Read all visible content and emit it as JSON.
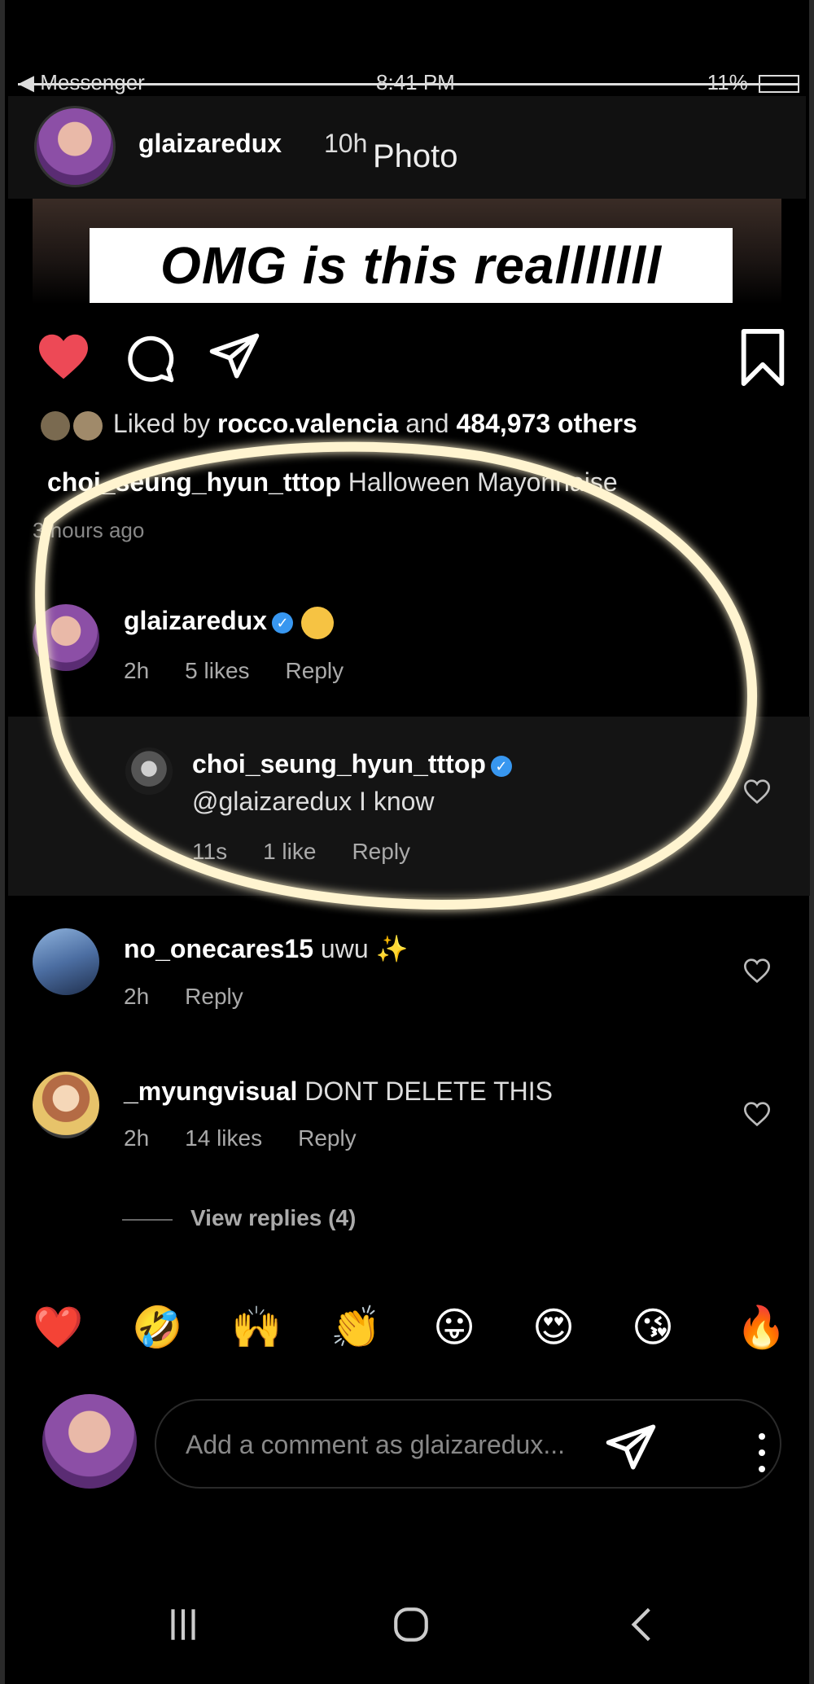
{
  "status_bar": {
    "back_app": "◀ Messenger",
    "time": "8:41 PM",
    "battery": "11%"
  },
  "post_header": {
    "username": "glaizaredux",
    "time_ago": "10h",
    "type": "Photo"
  },
  "photo_banner": "OMG is this realllllll",
  "likes": {
    "prefix": "Liked by ",
    "user": "rocco.valencia",
    "suffix": " and ",
    "count": "484,973 others"
  },
  "caption": {
    "username": "choi_seung_hyun_tttop",
    "text": "Halloween Mayonnaise"
  },
  "posted_ago": "3 hours ago",
  "comments": [
    {
      "username": "glaizaredux",
      "verified": true,
      "text": "😍",
      "time": "2h",
      "likes": "5 likes",
      "reply": "Reply"
    },
    {
      "username": "choi_seung_hyun_tttop",
      "verified": true,
      "text": "@glaizaredux I know",
      "time": "11s",
      "likes": "1 like",
      "reply": "Reply"
    },
    {
      "username": "no_onecares15",
      "text": "uwu ✨",
      "time": "2h",
      "reply": "Reply"
    },
    {
      "username": "_myungvisual",
      "text": "DONT DELETE THIS",
      "time": "2h",
      "likes": "14 likes",
      "reply": "Reply"
    }
  ],
  "view_replies": "View replies (4)",
  "emoji_bar": [
    "❤️",
    "🤣",
    "🙌",
    "👏",
    "😛",
    "😍",
    "😘",
    "🔥"
  ],
  "comment_input": {
    "placeholder": "Add a comment as glaizaredux..."
  },
  "colors": {
    "background": "#000000",
    "like_red": "#ed4956",
    "verified_blue": "#3897f0",
    "glow": "#fff4d0"
  },
  "icons": [
    "heart-icon",
    "comment-icon",
    "send-icon",
    "bookmark-icon",
    "wifi-icon",
    "signal-icon",
    "battery-icon",
    "recent-apps-icon",
    "home-icon",
    "back-icon",
    "more-vertical-icon"
  ]
}
